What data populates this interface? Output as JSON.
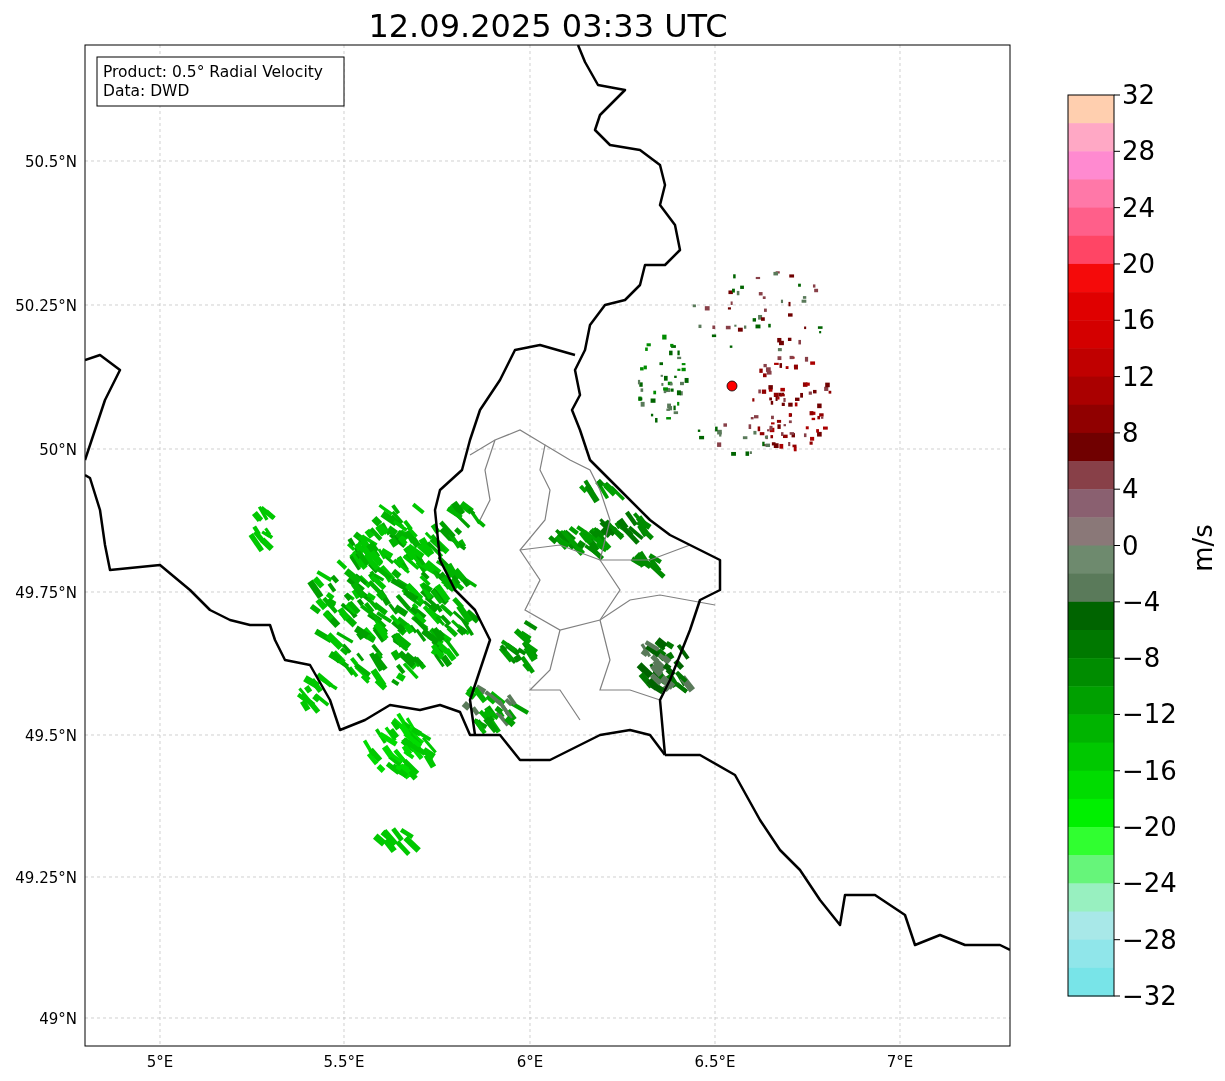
{
  "title": "12.09.2025 03:33 UTC",
  "info_box": [
    "Product: 0.5° Radial Velocity",
    "Data: DWD"
  ],
  "y_ticks": [
    "50.5°N",
    "50.25°N",
    "50°N",
    "49.75°N",
    "49.5°N",
    "49.25°N",
    "49°N"
  ],
  "x_ticks": [
    "5°E",
    "5.5°E",
    "6°E",
    "6.5°E",
    "7°E"
  ],
  "colorbar": {
    "label": "m/s",
    "ticks": [
      "32",
      "28",
      "24",
      "20",
      "16",
      "12",
      "8",
      "4",
      "0",
      "−4",
      "−8",
      "−12",
      "−16",
      "−20",
      "−24",
      "−28",
      "−32"
    ],
    "bands": [
      {
        "color": "#ffcfaf"
      },
      {
        "color": "#ffa8c5"
      },
      {
        "color": "#ff8ad0"
      },
      {
        "color": "#ff78a8"
      },
      {
        "color": "#ff5f8a"
      },
      {
        "color": "#ff4565"
      },
      {
        "color": "#f50a0a"
      },
      {
        "color": "#e00000"
      },
      {
        "color": "#d40000"
      },
      {
        "color": "#c00000"
      },
      {
        "color": "#aa0000"
      },
      {
        "color": "#900000"
      },
      {
        "color": "#700000"
      },
      {
        "color": "#884048"
      },
      {
        "color": "#8a6070"
      },
      {
        "color": "#8a7878"
      },
      {
        "color": "#6e8a6e"
      },
      {
        "color": "#5a7a5a"
      },
      {
        "color": "#006400"
      },
      {
        "color": "#007800"
      },
      {
        "color": "#008c00"
      },
      {
        "color": "#00a000"
      },
      {
        "color": "#00b400"
      },
      {
        "color": "#00c800"
      },
      {
        "color": "#00dc00"
      },
      {
        "color": "#00f000"
      },
      {
        "color": "#30ff30"
      },
      {
        "color": "#66f57a"
      },
      {
        "color": "#98f0c0"
      },
      {
        "color": "#a8e8e8"
      },
      {
        "color": "#90e6ea"
      },
      {
        "color": "#78e4e8"
      }
    ]
  }
}
